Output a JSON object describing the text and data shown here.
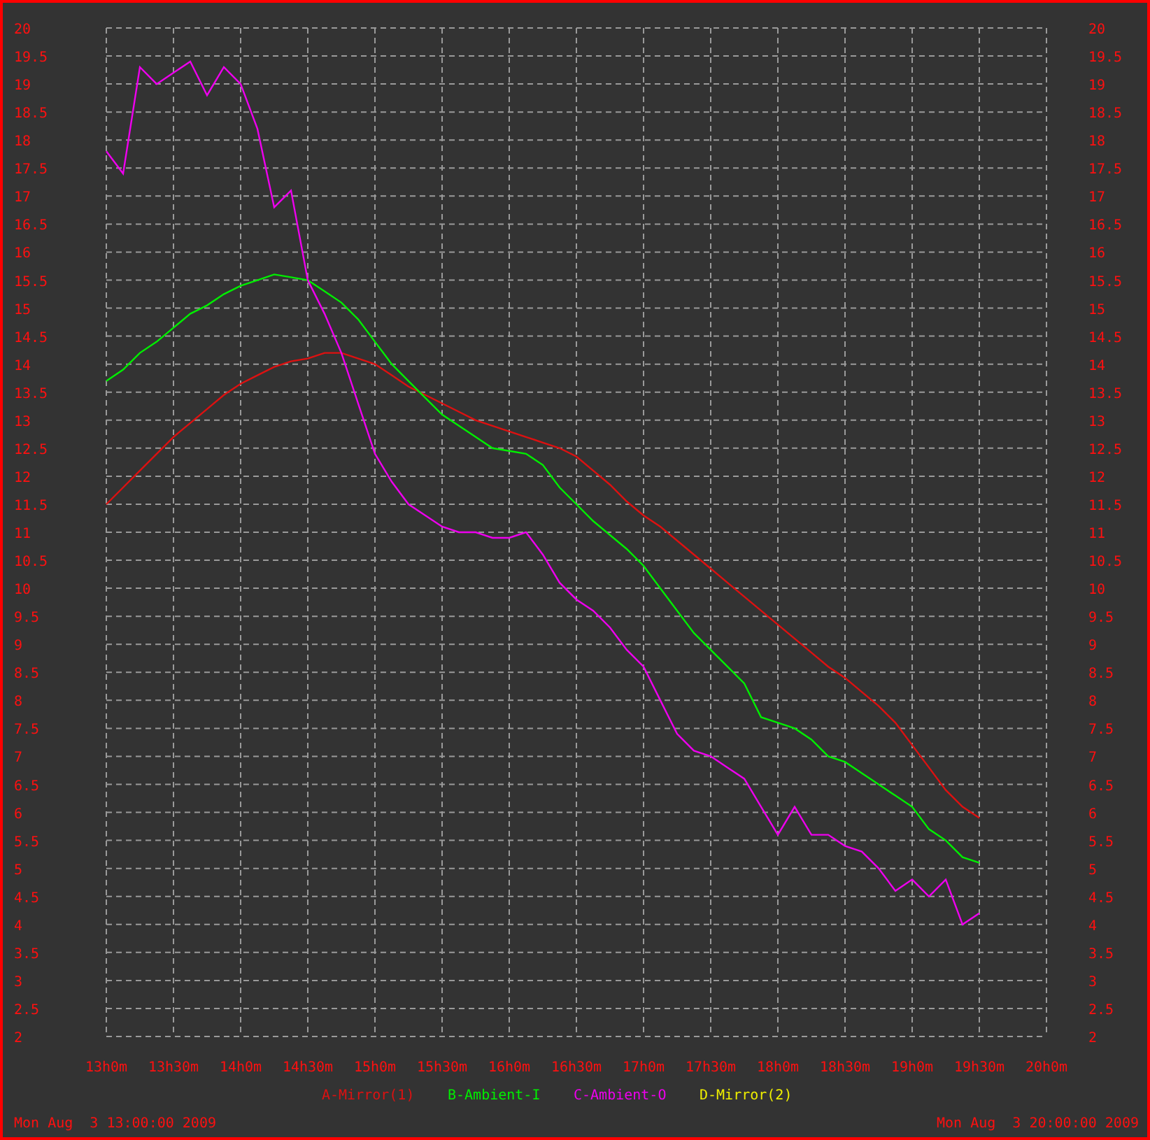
{
  "chart": {
    "chart_data": {
      "type": "line",
      "categories": [
        "13h0m",
        null,
        null,
        null,
        "13h30m",
        null,
        null,
        null,
        "14h0m",
        null,
        null,
        null,
        "14h30m",
        null,
        null,
        null,
        "15h0m",
        null,
        null,
        null,
        "15h30m",
        null,
        null,
        null,
        "16h0m",
        null,
        null,
        null,
        "16h30m",
        null,
        null,
        null,
        "17h0m",
        null,
        null,
        null,
        "17h30m",
        null,
        null,
        null,
        "18h0m",
        null,
        null,
        null,
        "18h30m",
        null,
        null,
        null,
        "19h0m",
        null,
        null,
        null,
        "19h30m",
        null,
        null,
        null,
        "20h0m"
      ],
      "ylim": [
        2,
        20
      ],
      "grid": true,
      "yticks": [
        2,
        2.5,
        3,
        3.5,
        4,
        4.5,
        5,
        5.5,
        6,
        6.5,
        7,
        7.5,
        8,
        8.5,
        9,
        9.5,
        10,
        10.5,
        11,
        11.5,
        12,
        12.5,
        13,
        13.5,
        14,
        14.5,
        15,
        15.5,
        16,
        16.5,
        17,
        17.5,
        18,
        18.5,
        19,
        19.5,
        20
      ],
      "series": [
        {
          "name": "A-Mirror(1)",
          "color": "#dd1111",
          "values": [
            11.5,
            11.8,
            12.1,
            12.4,
            12.7,
            12.95,
            13.2,
            13.45,
            13.65,
            13.8,
            13.95,
            14.05,
            14.1,
            14.2,
            14.2,
            14.1,
            14.0,
            13.8,
            13.6,
            13.45,
            13.3,
            13.15,
            13.0,
            12.9,
            12.8,
            12.7,
            12.6,
            12.5,
            12.35,
            12.1,
            11.85,
            11.55,
            11.3,
            11.1,
            10.85,
            10.6,
            10.35,
            10.1,
            9.85,
            9.6,
            9.35,
            9.1,
            8.85,
            8.6,
            8.4,
            8.15,
            7.9,
            7.6,
            7.2,
            6.8,
            6.4,
            6.1,
            5.9,
            null,
            null,
            null,
            null
          ]
        },
        {
          "name": "B-Ambient-I",
          "color": "#00ee00",
          "values": [
            13.7,
            13.9,
            14.2,
            14.4,
            14.65,
            14.9,
            15.05,
            15.25,
            15.4,
            15.5,
            15.6,
            15.55,
            15.5,
            15.3,
            15.1,
            14.8,
            14.4,
            14.0,
            13.7,
            13.4,
            13.1,
            12.9,
            12.7,
            12.5,
            12.45,
            12.4,
            12.2,
            11.8,
            11.5,
            11.2,
            10.95,
            10.7,
            10.4,
            10.0,
            9.6,
            9.2,
            8.9,
            8.6,
            8.3,
            7.7,
            7.6,
            7.5,
            7.3,
            7.0,
            6.9,
            6.7,
            6.5,
            6.3,
            6.1,
            5.7,
            5.5,
            5.2,
            5.1,
            null,
            null,
            null,
            null
          ]
        },
        {
          "name": "C-Ambient-O",
          "color": "#ee00ee",
          "values": [
            17.8,
            17.4,
            19.3,
            19.0,
            19.2,
            19.4,
            18.8,
            19.3,
            19.0,
            18.2,
            16.8,
            17.1,
            15.5,
            14.9,
            14.2,
            13.3,
            12.4,
            11.9,
            11.5,
            11.3,
            11.1,
            11.0,
            11.0,
            10.9,
            10.9,
            11.0,
            10.6,
            10.1,
            9.8,
            9.6,
            9.3,
            8.9,
            8.6,
            8.0,
            7.4,
            7.1,
            7.0,
            6.8,
            6.6,
            6.1,
            5.6,
            6.1,
            5.6,
            5.6,
            5.4,
            5.3,
            5.0,
            4.6,
            4.8,
            4.5,
            4.8,
            4.0,
            4.2,
            null,
            null,
            null,
            null
          ]
        },
        {
          "name": "D-Mirror(2)",
          "color": "#eeee00",
          "values": [
            null,
            null,
            null,
            null,
            null,
            null,
            null,
            null,
            null,
            null,
            null,
            null,
            null,
            null,
            null,
            null,
            null,
            null,
            null,
            null,
            null,
            null,
            null,
            null,
            null,
            null,
            null,
            null,
            null,
            null,
            null,
            null,
            null,
            null,
            null,
            null,
            null,
            null,
            null,
            null,
            null,
            null,
            null,
            null,
            null,
            null,
            null,
            null,
            null,
            null,
            null,
            null,
            null,
            null,
            null,
            null,
            null
          ]
        }
      ]
    },
    "right_axis_labels": [
      "20",
      "19.5",
      "19",
      "18.5",
      "18",
      "17.5",
      "17",
      "16.5",
      "16",
      "15.5",
      "15",
      "14.5",
      "14",
      "13.5",
      "13",
      "12.5",
      "12",
      "11.5",
      "11",
      "10.5",
      "10",
      "9.5",
      "9",
      "8.5",
      "8",
      "7.5",
      "7",
      "6.5",
      "6",
      "5.5",
      "5",
      "4.5",
      "4",
      "3.5",
      "3",
      "2.5",
      "2"
    ]
  },
  "footer": {
    "start_time": "Mon Aug  3 13:00:00 2009",
    "end_time": "Mon Aug  3 20:00:00 2009"
  }
}
